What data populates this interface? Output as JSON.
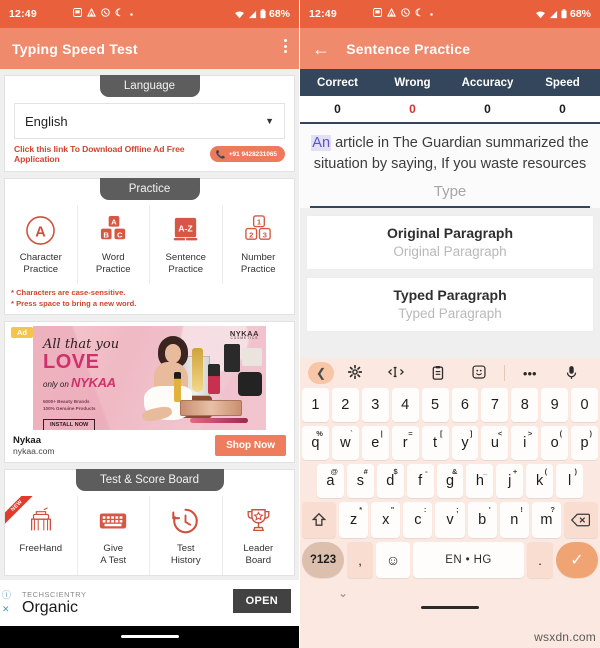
{
  "status_bar": {
    "time": "12:49",
    "left_icons": [
      "screenshot-icon",
      "triangle-app-icon",
      "whatsapp-icon",
      "crescent-moon-icon",
      "dot-icon"
    ],
    "battery": "68%",
    "right_icons": [
      "wifi-icon",
      "signal-icon",
      "battery-icon"
    ]
  },
  "left_screen": {
    "appbar": {
      "title": "Typing Speed Test",
      "menu_icon": "kebab-menu-icon"
    },
    "language_card": {
      "tab_label": "Language",
      "selected": "English",
      "caret_icon": "chevron-down-icon",
      "link_text": "Click this link To Download Offline Ad Free Application",
      "phone": "+91 9428231065",
      "phone_icon": "phone-icon"
    },
    "practice_card": {
      "tab_label": "Practice",
      "items": [
        {
          "label": "Character\nPractice",
          "line1": "Character",
          "line2": "Practice",
          "icon": "circle-a-icon"
        },
        {
          "label": "Word Practice",
          "line1": "Word",
          "line2": "Practice",
          "icon": "abc-blocks-icon"
        },
        {
          "label": "Sentence Practice",
          "line1": "Sentence",
          "line2": "Practice",
          "icon": "az-book-icon"
        },
        {
          "label": "Number Practice",
          "line1": "Number",
          "line2": "Practice",
          "icon": "123-blocks-icon"
        }
      ],
      "notes": [
        "* Characters are case-sensitive.",
        "* Press space to bring a new word."
      ]
    },
    "ad": {
      "badge": "Ad",
      "brand_logo": "NYKAA",
      "brand_logo_sub": "COSMETICS",
      "headline_script": "All that you",
      "headline_big": "LOVE",
      "headline_only": "only on",
      "headline_brand": "NYKAA",
      "sub1": "5000+ Beauty Brands",
      "sub2": "100% Genuine Products",
      "cta_in_banner": "INSTALL NOW",
      "advertiser": "Nykaa",
      "url": "nykaa.com",
      "cta": "Shop Now"
    },
    "score_card": {
      "tab_label": "Test & Score Board",
      "items": [
        {
          "line1": "FreeHand",
          "line2": "",
          "icon": "freehand-writing-icon",
          "ribbon": "NEW"
        },
        {
          "line1": "Give",
          "line2": "A Test",
          "icon": "keyboard-icon",
          "ribbon": ""
        },
        {
          "line1": "Test",
          "line2": "History",
          "icon": "history-clock-icon",
          "ribbon": ""
        },
        {
          "line1": "Leader",
          "line2": "Board",
          "icon": "trophy-icon",
          "ribbon": ""
        }
      ]
    },
    "bottom_ad": {
      "brand": "TECHSCIENTRY",
      "title": "Organic",
      "cta": "OPEN",
      "info_icon": "info-icon",
      "close_icon": "close-icon"
    }
  },
  "right_screen": {
    "appbar": {
      "title": "Sentence Practice",
      "back_icon": "arrow-left-icon"
    },
    "stats": {
      "headers": [
        "Correct",
        "Wrong",
        "Accuracy",
        "Speed"
      ],
      "values": [
        "0",
        "0",
        "0",
        "0"
      ]
    },
    "sentence": {
      "current_word": "An",
      "rest": " article in The Guardian summarized the situation by saying, If you waste resources"
    },
    "type_input": {
      "placeholder": "Type",
      "value": ""
    },
    "paragraph_cards": [
      {
        "title": "Original Paragraph",
        "subtitle": "Original Paragraph"
      },
      {
        "title": "Typed Paragraph",
        "subtitle": "Typed Paragraph"
      }
    ],
    "keyboard": {
      "toolbar_icons": [
        "chevron-left-icon",
        "gear-icon",
        "cursor-move-icon",
        "clipboard-icon",
        "sticker-icon",
        "more-horizontal-icon",
        "microphone-icon"
      ],
      "row_numbers": [
        "1",
        "2",
        "3",
        "4",
        "5",
        "6",
        "7",
        "8",
        "9",
        "0"
      ],
      "row_top": [
        {
          "k": "q",
          "s": "%"
        },
        {
          "k": "w",
          "s": "`"
        },
        {
          "k": "e",
          "s": "|"
        },
        {
          "k": "r",
          "s": "="
        },
        {
          "k": "t",
          "s": "["
        },
        {
          "k": "y",
          "s": "]"
        },
        {
          "k": "u",
          "s": "<"
        },
        {
          "k": "i",
          "s": ">"
        },
        {
          "k": "o",
          "s": "("
        },
        {
          "k": "p",
          "s": ")"
        }
      ],
      "row_home": [
        {
          "k": "a",
          "s": "@"
        },
        {
          "k": "s",
          "s": "#"
        },
        {
          "k": "d",
          "s": "$"
        },
        {
          "k": "f",
          "s": "-"
        },
        {
          "k": "g",
          "s": "&"
        },
        {
          "k": "h",
          "s": "_"
        },
        {
          "k": "j",
          "s": "+"
        },
        {
          "k": "k",
          "s": "("
        },
        {
          "k": "l",
          "s": ")"
        }
      ],
      "row_bottom": [
        {
          "k": "z",
          "s": "*"
        },
        {
          "k": "x",
          "s": "\""
        },
        {
          "k": "c",
          "s": ":"
        },
        {
          "k": "v",
          "s": ";"
        },
        {
          "k": "b",
          "s": "'"
        },
        {
          "k": "n",
          "s": "!"
        },
        {
          "k": "m",
          "s": "?"
        }
      ],
      "shift_icon": "shift-icon",
      "backspace_icon": "backspace-icon",
      "symbols_key": "?123",
      "comma_key": ",",
      "emoji_icon": "emoji-icon",
      "space_key": "EN • HG",
      "period_key": ".",
      "enter_icon": "check-icon",
      "collapse_icon": "chevron-down-icon"
    }
  },
  "watermark": "wsxdn.com",
  "colors": {
    "status_bar": "#e8613c",
    "app_bar": "#ef8a6c",
    "accent": "#e05a3a",
    "stats_header": "#33465c",
    "wrong_value": "#d4342a",
    "keyboard_bg": "#fbe9e1",
    "enter_key": "#f0a473"
  }
}
